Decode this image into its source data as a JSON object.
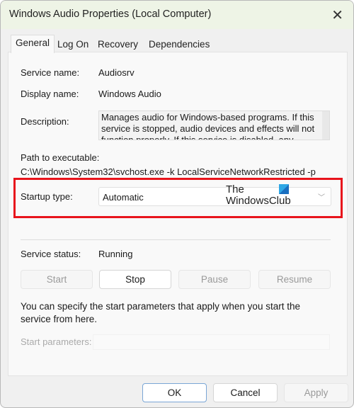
{
  "window": {
    "title": "Windows Audio Properties (Local Computer)",
    "close_icon": "close-icon"
  },
  "tabs": [
    {
      "label": "General",
      "active": true
    },
    {
      "label": "Log On"
    },
    {
      "label": "Recovery"
    },
    {
      "label": "Dependencies"
    }
  ],
  "general": {
    "service_name_label": "Service name:",
    "service_name": "Audiosrv",
    "display_name_label": "Display name:",
    "display_name": "Windows Audio",
    "description_label": "Description:",
    "description": "Manages audio for Windows-based programs.  If this service is stopped, audio devices and effects will not function properly.  If this service is disabled, any",
    "path_label": "Path to executable:",
    "path": "C:\\Windows\\System32\\svchost.exe -k LocalServiceNetworkRestricted -p",
    "startup_type_label": "Startup type:",
    "startup_type": "Automatic",
    "service_status_label": "Service status:",
    "service_status": "Running",
    "buttons": {
      "start": "Start",
      "stop": "Stop",
      "pause": "Pause",
      "resume": "Resume"
    },
    "help_text": "You can specify the start parameters that apply when you start the service from here.",
    "start_params_label": "Start parameters:",
    "start_params_value": ""
  },
  "watermark": {
    "line1": "The",
    "line2": "WindowsClub"
  },
  "highlight_color": "#e8141c",
  "footer": {
    "ok": "OK",
    "cancel": "Cancel",
    "apply": "Apply"
  }
}
